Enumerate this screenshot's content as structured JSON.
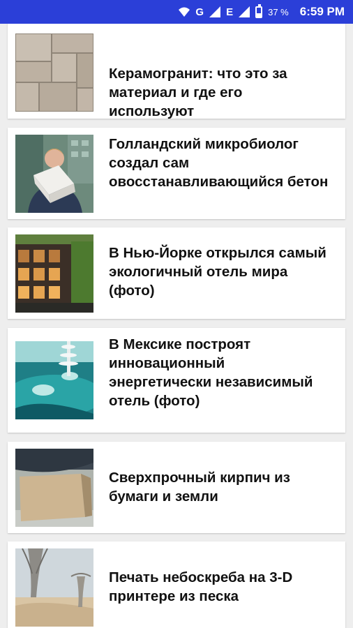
{
  "status_bar": {
    "network_g": "G",
    "network_e": "E",
    "battery_percent": "37 %",
    "time": "6:59 PM",
    "icons": [
      "wifi-icon",
      "signal-icon",
      "signal-icon",
      "battery-icon"
    ]
  },
  "articles": [
    {
      "title": "Керамогранит: что это за материал и где его используют",
      "thumbnail": "stone-tiles-image"
    },
    {
      "title": "Голландский микробиолог создал самовосстанавливающийся бетон",
      "title_display": "Голландский микробиолог создал сам овосстанавливающийся бетон",
      "thumbnail": "man-holding-concrete-block-image"
    },
    {
      "title": "В Нью-Йорке открылся самый экологичный отель мира (фото)",
      "thumbnail": "green-hotel-facade-image"
    },
    {
      "title": "В Мексике построят инновационный энергетически независимый отель (фото)",
      "thumbnail": "ocean-hotel-render-image"
    },
    {
      "title": "Сверхпрочный кирпич из бумаги и земли",
      "thumbnail": "paper-earth-brick-image"
    },
    {
      "title": "Печать небоскреба на 3-D принтере из песка",
      "thumbnail": "desert-skyscraper-render-image"
    }
  ]
}
